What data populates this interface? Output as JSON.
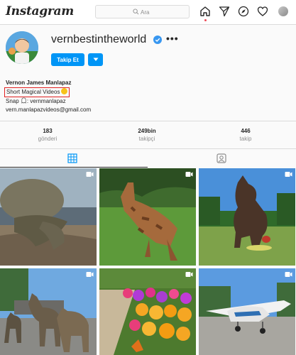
{
  "header": {
    "logo_text": "Instagram",
    "search_placeholder": "Ara",
    "nav_icons": [
      "home-icon",
      "direct-icon",
      "explore-icon",
      "activity-icon",
      "profile-avatar"
    ]
  },
  "profile": {
    "username": "vernbestintheworld",
    "verified": true,
    "follow_label": "Takip Et",
    "full_name": "Vernon James Manlapaz",
    "category": "Short Magical Videos",
    "snap_label": "Snap",
    "snap_handle": ": vernmanlapaz",
    "email": "vern.manlapazvideos@gmail.com"
  },
  "stats": {
    "posts": {
      "value": "183",
      "label": "gönderi"
    },
    "followers": {
      "value": "249bin",
      "label": "takipçi"
    },
    "following": {
      "value": "446",
      "label": "takip"
    }
  },
  "tabs": [
    {
      "icon": "grid-icon",
      "active": true
    },
    {
      "icon": "tagged-icon",
      "active": false
    }
  ],
  "posts": [
    {
      "subject": "turtle on beach",
      "type": "video"
    },
    {
      "subject": "giraffe in park",
      "type": "video"
    },
    {
      "subject": "dog statue on lawn",
      "type": "video"
    },
    {
      "subject": "camels on street",
      "type": "video"
    },
    {
      "subject": "flowers on path",
      "type": "video"
    },
    {
      "subject": "small airplane",
      "type": "video"
    }
  ],
  "colors": {
    "accent": "#0095f6",
    "highlight_box": "#e02020",
    "border": "#dbdbdb",
    "notification_dot": "#ed4956"
  }
}
